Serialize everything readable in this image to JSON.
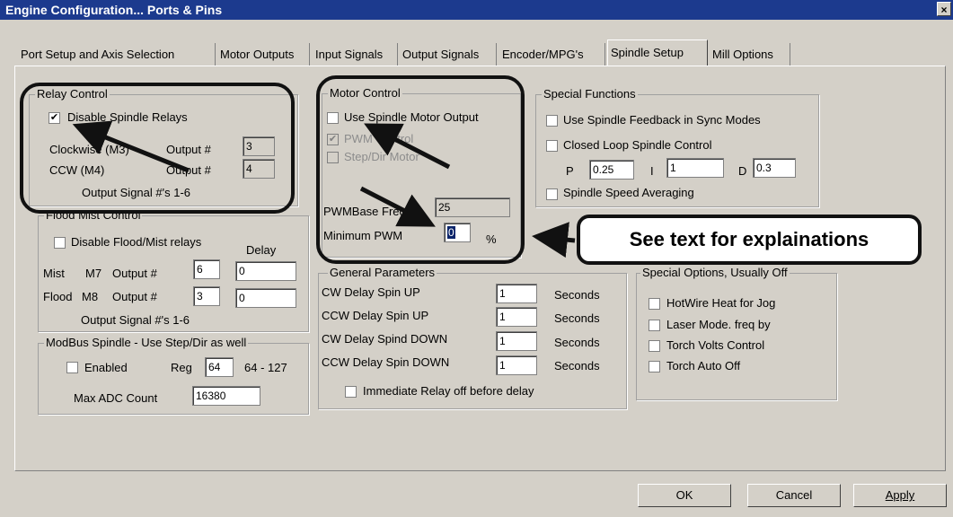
{
  "window": {
    "title": "Engine Configuration... Ports & Pins",
    "close_glyph": "×"
  },
  "tabs": [
    {
      "label": "Port Setup and Axis Selection"
    },
    {
      "label": "Motor Outputs"
    },
    {
      "label": "Input Signals"
    },
    {
      "label": "Output Signals"
    },
    {
      "label": "Encoder/MPG's"
    },
    {
      "label": "Spindle Setup",
      "active": true
    },
    {
      "label": "Mill Options"
    }
  ],
  "relay_control": {
    "title": "Relay Control",
    "disable_label": "Disable Spindle Relays",
    "disable_checked": true,
    "check_glyph": "✔",
    "cw_label": "Clockwise (M3)",
    "ccw_label": "CCW (M4)",
    "output_label": "Output #",
    "cw_value": "3",
    "ccw_value": "4",
    "signals_note": "Output Signal #'s 1-6"
  },
  "flood_mist": {
    "title": "Flood Mist Control",
    "disable_label": "Disable Flood/Mist relays",
    "delay_label": "Delay",
    "mist_label": "Mist",
    "mist_code": "M7",
    "flood_label": "Flood",
    "flood_code": "M8",
    "output_label": "Output #",
    "mist_output": "6",
    "mist_delay": "0",
    "flood_output": "3",
    "flood_delay": "0",
    "signals_note": "Output Signal #'s 1-6"
  },
  "modbus": {
    "title": "ModBus Spindle - Use Step/Dir as well",
    "enabled_label": "Enabled",
    "reg_label": "Reg",
    "reg_value": "64",
    "reg_range": "64 - 127",
    "max_adc_label": "Max ADC Count",
    "max_adc_value": "16380"
  },
  "motor_control": {
    "title": "Motor Control",
    "use_output_label": "Use Spindle Motor Output",
    "pwm_control_label": "PWM Control",
    "step_dir_label": "Step/Dir Motor",
    "pwm_base_label": "PWMBase Freq.",
    "pwm_base_value": "25",
    "min_pwm_label": "Minimum PWM",
    "min_pwm_value": "0",
    "percent": "%"
  },
  "special_functions": {
    "title": "Special Functions",
    "feedback_label": "Use Spindle Feedback in Sync Modes",
    "closed_loop_label": "Closed Loop Spindle Control",
    "p_label": "P",
    "p_value": "0.25",
    "i_label": "I",
    "i_value": "1",
    "d_label": "D",
    "d_value": "0.3",
    "averaging_label": "Spindle Speed Averaging"
  },
  "general": {
    "title": "General Parameters",
    "rows": [
      {
        "label": "CW Delay Spin UP",
        "value": "1",
        "unit": "Seconds"
      },
      {
        "label": "CCW Delay Spin UP",
        "value": "1",
        "unit": "Seconds"
      },
      {
        "label": "CW Delay Spind DOWN",
        "value": "1",
        "unit": "Seconds"
      },
      {
        "label": "CCW Delay Spin DOWN",
        "value": "1",
        "unit": "Seconds"
      }
    ],
    "immediate_label": "Immediate Relay off before delay"
  },
  "special_options": {
    "title": "Special Options, Usually Off",
    "items": [
      {
        "label": "HotWire Heat for Jog"
      },
      {
        "label": "Laser Mode. freq by"
      },
      {
        "label": "Torch Volts Control"
      },
      {
        "label": "Torch Auto Off"
      }
    ]
  },
  "annotation": {
    "text": "See text for explainations"
  },
  "buttons": {
    "ok": "OK",
    "cancel": "Cancel",
    "apply": "Apply"
  }
}
